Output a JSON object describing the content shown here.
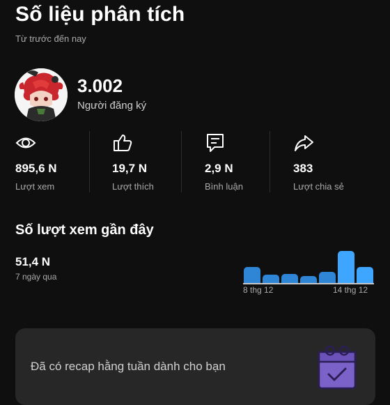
{
  "header": {
    "title": "Số liệu phân tích",
    "subtitle": "Từ trước đến nay"
  },
  "channel": {
    "subscribers": "3.002",
    "subscribers_label": "Người đăng ký"
  },
  "stats": [
    {
      "icon": "eye-icon",
      "value": "895,6 N",
      "label": "Lượt xem"
    },
    {
      "icon": "thumbs-up-icon",
      "value": "19,7 N",
      "label": "Lượt thích"
    },
    {
      "icon": "comment-icon",
      "value": "2,9 N",
      "label": "Bình luận"
    },
    {
      "icon": "share-icon",
      "value": "383",
      "label": "Lượt chia sẻ"
    }
  ],
  "recent_views": {
    "title": "Số lượt xem gần đây",
    "value": "51,4 N",
    "period": "7 ngày qua"
  },
  "chart_data": {
    "type": "bar",
    "categories": [
      "8 thg 12",
      "",
      "",
      "",
      "",
      "",
      "14 thg 12"
    ],
    "values": [
      0.49,
      0.27,
      0.29,
      0.22,
      0.35,
      1.0,
      0.51
    ],
    "xlabel": "",
    "ylabel": "",
    "highlight_color": "#3ea6ff",
    "bar_color": "#2f86d6",
    "grid": false
  },
  "recap_card": {
    "text": "Đã có recap hằng tuần dành cho bạn",
    "icon": "calendar-check-icon"
  },
  "colors": {
    "background": "#0f0f0f",
    "accent": "#3ea6ff",
    "card": "#272727",
    "recap_icon": "#7b62c9"
  }
}
